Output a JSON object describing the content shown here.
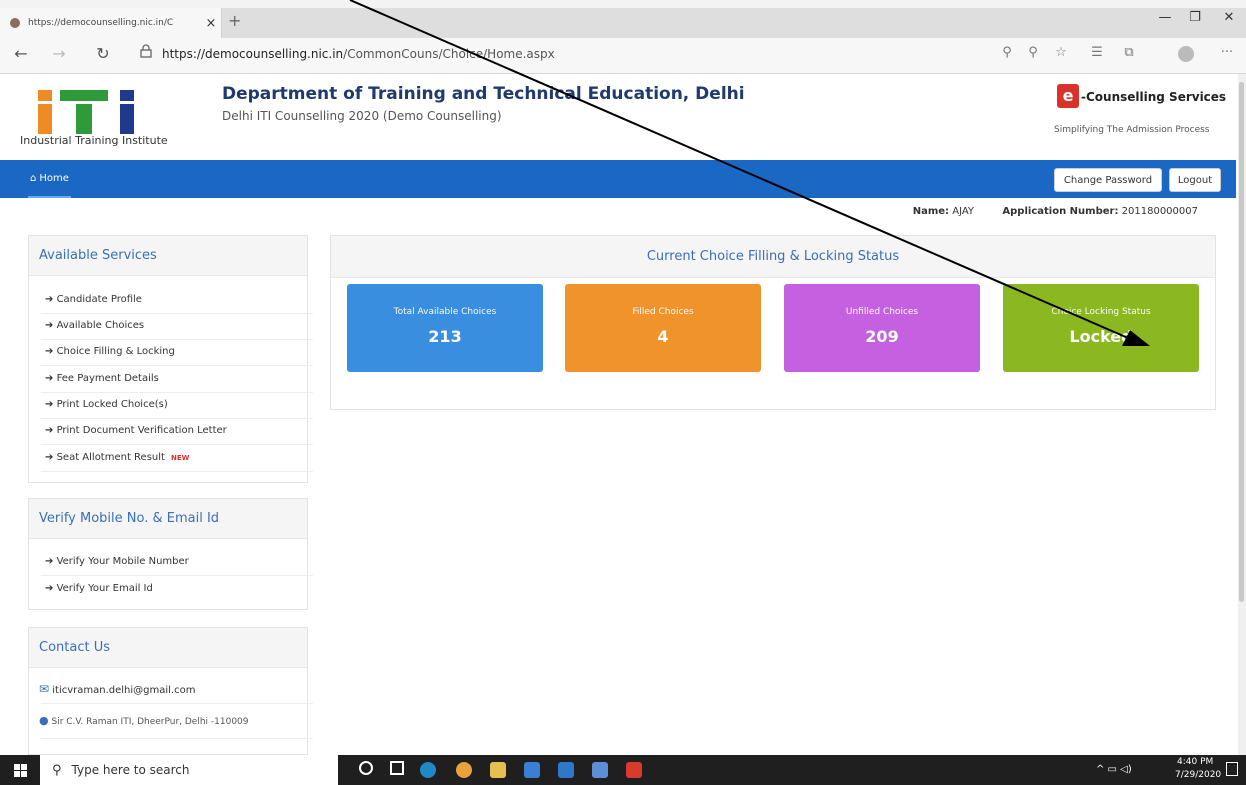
{
  "browser": {
    "tab_title": "https://democounselling.nic.in/C",
    "tab_close": "×",
    "new_tab": "+",
    "url_domain": "https://democounselling.nic.in",
    "url_path": "/CommonCouns/Choice/Home.aspx",
    "icons": [
      "back-icon",
      "forward-icon",
      "refresh-icon",
      "lock-icon",
      "zoom-icon",
      "favorite-icon",
      "favorites-list-icon",
      "collections-icon",
      "profile-icon",
      "more-icon"
    ]
  },
  "header": {
    "logo_caption": "Industrial Training Institute",
    "title": "Department of Training and Technical Education, Delhi",
    "subtitle": "Delhi ITI Counselling 2020 (Demo Counselling)",
    "ec_mark": "e",
    "ec_title": "-Counselling Services",
    "ec_tagline": "Simplifying The Admission Process"
  },
  "nav": {
    "home": "Home",
    "change_password": "Change Password",
    "logout": "Logout"
  },
  "user": {
    "name_label": "Name:",
    "name": "AJAY",
    "app_label": "Application Number:",
    "app_number": "201180000007"
  },
  "services": {
    "title": "Available Services",
    "items": [
      "Candidate Profile",
      "Available Choices",
      "Choice Filling & Locking",
      "Fee Payment Details",
      "Print Locked Choice(s)",
      "Print Document Verification Letter",
      "Seat Allotment Result"
    ],
    "new_badge": "NEW"
  },
  "verify": {
    "title": "Verify Mobile No. & Email Id",
    "items": [
      "Verify Your Mobile Number",
      "Verify Your Email Id"
    ]
  },
  "contact": {
    "title": "Contact Us",
    "email": "iticvraman.delhi@gmail.com",
    "address": "Sir C.V. Raman ITI, DheerPur, Delhi -110009"
  },
  "status": {
    "title": "Current Choice Filling & Locking Status",
    "cards": [
      {
        "label": "Total Available Choices",
        "value": "213",
        "color": "#3a8ee0"
      },
      {
        "label": "Filled Choices",
        "value": "4",
        "color": "#f0932b"
      },
      {
        "label": "Unfilled Choices",
        "value": "209",
        "color": "#c561e0"
      },
      {
        "label": "Choice Locking Status",
        "value": "Locked",
        "color": "#8bb820"
      }
    ]
  },
  "taskbar": {
    "search_placeholder": "Type here to search",
    "time": "4:40 PM",
    "date": "7/29/2020"
  }
}
